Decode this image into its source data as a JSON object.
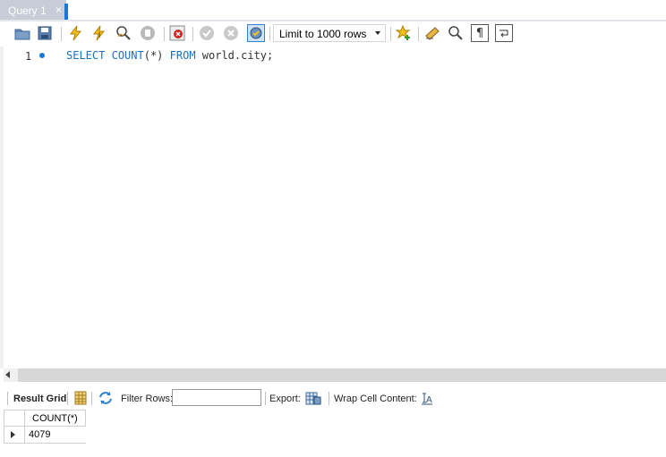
{
  "tab": {
    "label": "Query 1",
    "close": "×"
  },
  "toolbar": {
    "limit_label": "Limit to 1000 rows",
    "icons": [
      "open-folder-icon",
      "save-icon",
      "execute-icon",
      "execute-current-icon",
      "explain-icon",
      "stop-icon",
      "toggle-autocommit-icon",
      "commit-icon",
      "rollback-icon",
      "toggle-error-icon",
      "add-snippet-icon",
      "beautify-icon",
      "find-icon",
      "invisible-chars-icon",
      "wrap-lines-icon"
    ]
  },
  "editor": {
    "line_number": "1",
    "code": {
      "k1": "SELECT",
      "f1": "COUNT",
      "s1": "(*)",
      "k2": "FROM",
      "t": "world.city;"
    }
  },
  "results": {
    "result_grid_label": "Result Grid",
    "filter_label": "Filter Rows:",
    "filter_value": "",
    "export_label": "Export:",
    "wrap_label": "Wrap Cell Content:",
    "columns": [
      "COUNT(*)"
    ],
    "rows": [
      [
        "4079"
      ]
    ]
  }
}
